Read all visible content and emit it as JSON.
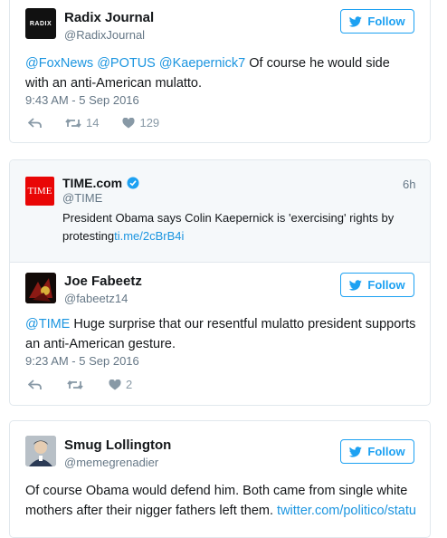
{
  "tweets": [
    {
      "name": "Radix Journal",
      "handle": "@RadixJournal",
      "avatar_text": "RADIX",
      "follow_label": "Follow",
      "mentions": [
        "@FoxNews",
        "@POTUS",
        "@Kaepernick7"
      ],
      "text": " Of course he would side with an anti-American mulatto.",
      "timestamp": "9:43 AM - 5 Sep 2016",
      "retweets": "14",
      "likes": "129"
    },
    {
      "quoted": {
        "name": "TIME.com",
        "handle": "@TIME",
        "avatar_text": "TIME",
        "time_ago": "6h",
        "text": "President Obama says Colin Kaepernick is 'exercising' rights by protesting",
        "link": "ti.me/2cBrB4i"
      },
      "name": "Joe Fabeetz",
      "handle": "@fabeetz14",
      "follow_label": "Follow",
      "mention": "@TIME",
      "text": " Huge surprise that our resentful mulatto president supports an anti-American gesture.",
      "timestamp": "9:23 AM - 5 Sep 2016",
      "likes": "2"
    },
    {
      "name": "Smug Lollington",
      "handle": "@memegrenadier",
      "follow_label": "Follow",
      "text": "Of course Obama would defend him. Both came from single white mothers after their nigger fathers left them. ",
      "link": "twitter.com/politico/statu"
    }
  ],
  "colors": {
    "accent": "#1da1f2",
    "link": "#1b95e0",
    "muted": "#657786",
    "border": "#e1e8ed",
    "time_red": "#e90606"
  }
}
